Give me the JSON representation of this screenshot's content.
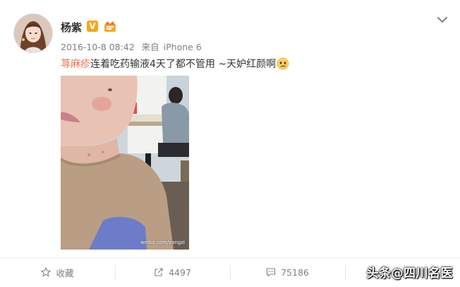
{
  "user": {
    "name": "杨紫",
    "verified_badge": "V",
    "verified_color": "#f7a61c"
  },
  "meta": {
    "time": "2016-10-8 08:42",
    "source_prefix": "来自",
    "device": "iPhone 6"
  },
  "post": {
    "hashtag": "荨麻疹",
    "body": "连着吃药输液4天了都不管用 ~天妒红颜啊",
    "emoji": "sad-face-emoji",
    "hashtag_color": "#eb7350"
  },
  "photo": {
    "watermark": "weibo.com/yangzi"
  },
  "actions": {
    "favorite_label": "收藏",
    "repost_count": "4497",
    "comment_count": "75186",
    "like_count": ""
  },
  "overlay": {
    "source_watermark": "头条@四川名医"
  }
}
